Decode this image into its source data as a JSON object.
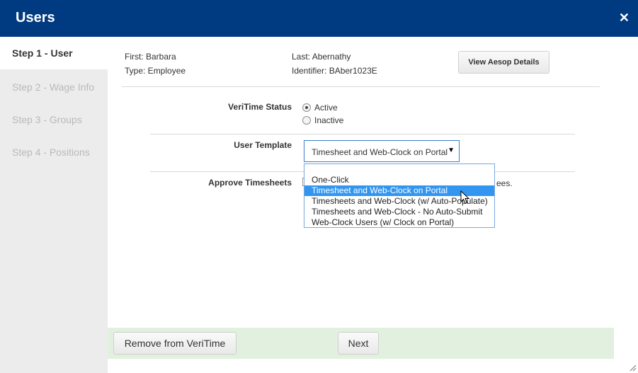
{
  "window": {
    "title": "Users"
  },
  "steps": [
    {
      "label": "Step 1 - User",
      "active": true
    },
    {
      "label": "Step 2 - Wage Info",
      "active": false
    },
    {
      "label": "Step 3 - Groups",
      "active": false
    },
    {
      "label": "Step 4 - Positions",
      "active": false
    }
  ],
  "user": {
    "first": "First: Barbara",
    "last": "Last: Abernathy",
    "type": "Type: Employee",
    "identifier": "Identifier: BAber1023E"
  },
  "buttons": {
    "view_aesop": "View Aesop Details",
    "remove": "Remove from VeriTime",
    "next": "Next"
  },
  "veritime_status": {
    "label": "VeriTime Status",
    "options": [
      "Active",
      "Inactive"
    ],
    "selected": "Active"
  },
  "user_template": {
    "label": "User Template",
    "value": "Timesheet and Web-Clock on Portal",
    "options": [
      "One-Click",
      "Timesheet and Web-Clock on Portal",
      "Timesheets and Web-Clock (w/ Auto-Populate)",
      "Timesheets and Web-Clock - No Auto-Submit",
      "Web-Clock Users (w/ Clock on Portal)"
    ],
    "highlighted_index": 1
  },
  "approve_timesheets": {
    "label": "Approve Timesheets",
    "trailing_text": "ees."
  },
  "colors": {
    "titlebar": "#003a80",
    "sidebar": "#ececec",
    "footer": "#e2f1df",
    "highlight": "#3296f0"
  }
}
